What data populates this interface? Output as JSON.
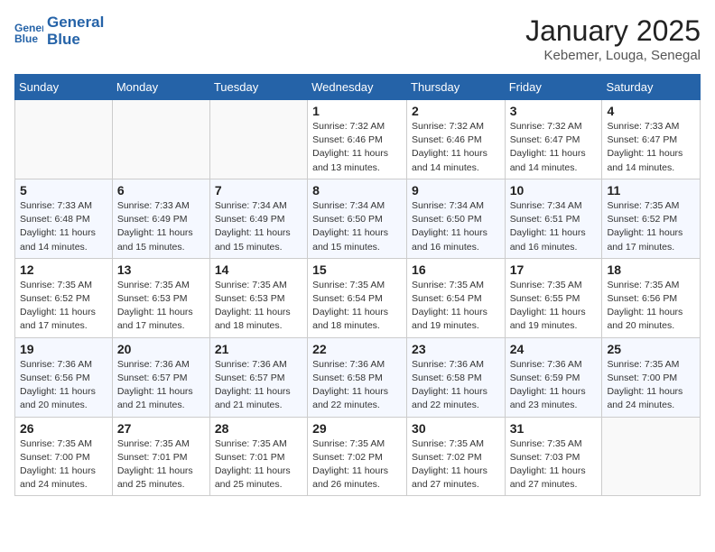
{
  "header": {
    "logo_line1": "General",
    "logo_line2": "Blue",
    "month_title": "January 2025",
    "location": "Kebemer, Louga, Senegal"
  },
  "weekdays": [
    "Sunday",
    "Monday",
    "Tuesday",
    "Wednesday",
    "Thursday",
    "Friday",
    "Saturday"
  ],
  "weeks": [
    [
      {
        "day": "",
        "info": ""
      },
      {
        "day": "",
        "info": ""
      },
      {
        "day": "",
        "info": ""
      },
      {
        "day": "1",
        "info": "Sunrise: 7:32 AM\nSunset: 6:46 PM\nDaylight: 11 hours\nand 13 minutes."
      },
      {
        "day": "2",
        "info": "Sunrise: 7:32 AM\nSunset: 6:46 PM\nDaylight: 11 hours\nand 14 minutes."
      },
      {
        "day": "3",
        "info": "Sunrise: 7:32 AM\nSunset: 6:47 PM\nDaylight: 11 hours\nand 14 minutes."
      },
      {
        "day": "4",
        "info": "Sunrise: 7:33 AM\nSunset: 6:47 PM\nDaylight: 11 hours\nand 14 minutes."
      }
    ],
    [
      {
        "day": "5",
        "info": "Sunrise: 7:33 AM\nSunset: 6:48 PM\nDaylight: 11 hours\nand 14 minutes."
      },
      {
        "day": "6",
        "info": "Sunrise: 7:33 AM\nSunset: 6:49 PM\nDaylight: 11 hours\nand 15 minutes."
      },
      {
        "day": "7",
        "info": "Sunrise: 7:34 AM\nSunset: 6:49 PM\nDaylight: 11 hours\nand 15 minutes."
      },
      {
        "day": "8",
        "info": "Sunrise: 7:34 AM\nSunset: 6:50 PM\nDaylight: 11 hours\nand 15 minutes."
      },
      {
        "day": "9",
        "info": "Sunrise: 7:34 AM\nSunset: 6:50 PM\nDaylight: 11 hours\nand 16 minutes."
      },
      {
        "day": "10",
        "info": "Sunrise: 7:34 AM\nSunset: 6:51 PM\nDaylight: 11 hours\nand 16 minutes."
      },
      {
        "day": "11",
        "info": "Sunrise: 7:35 AM\nSunset: 6:52 PM\nDaylight: 11 hours\nand 17 minutes."
      }
    ],
    [
      {
        "day": "12",
        "info": "Sunrise: 7:35 AM\nSunset: 6:52 PM\nDaylight: 11 hours\nand 17 minutes."
      },
      {
        "day": "13",
        "info": "Sunrise: 7:35 AM\nSunset: 6:53 PM\nDaylight: 11 hours\nand 17 minutes."
      },
      {
        "day": "14",
        "info": "Sunrise: 7:35 AM\nSunset: 6:53 PM\nDaylight: 11 hours\nand 18 minutes."
      },
      {
        "day": "15",
        "info": "Sunrise: 7:35 AM\nSunset: 6:54 PM\nDaylight: 11 hours\nand 18 minutes."
      },
      {
        "day": "16",
        "info": "Sunrise: 7:35 AM\nSunset: 6:54 PM\nDaylight: 11 hours\nand 19 minutes."
      },
      {
        "day": "17",
        "info": "Sunrise: 7:35 AM\nSunset: 6:55 PM\nDaylight: 11 hours\nand 19 minutes."
      },
      {
        "day": "18",
        "info": "Sunrise: 7:35 AM\nSunset: 6:56 PM\nDaylight: 11 hours\nand 20 minutes."
      }
    ],
    [
      {
        "day": "19",
        "info": "Sunrise: 7:36 AM\nSunset: 6:56 PM\nDaylight: 11 hours\nand 20 minutes."
      },
      {
        "day": "20",
        "info": "Sunrise: 7:36 AM\nSunset: 6:57 PM\nDaylight: 11 hours\nand 21 minutes."
      },
      {
        "day": "21",
        "info": "Sunrise: 7:36 AM\nSunset: 6:57 PM\nDaylight: 11 hours\nand 21 minutes."
      },
      {
        "day": "22",
        "info": "Sunrise: 7:36 AM\nSunset: 6:58 PM\nDaylight: 11 hours\nand 22 minutes."
      },
      {
        "day": "23",
        "info": "Sunrise: 7:36 AM\nSunset: 6:58 PM\nDaylight: 11 hours\nand 22 minutes."
      },
      {
        "day": "24",
        "info": "Sunrise: 7:36 AM\nSunset: 6:59 PM\nDaylight: 11 hours\nand 23 minutes."
      },
      {
        "day": "25",
        "info": "Sunrise: 7:35 AM\nSunset: 7:00 PM\nDaylight: 11 hours\nand 24 minutes."
      }
    ],
    [
      {
        "day": "26",
        "info": "Sunrise: 7:35 AM\nSunset: 7:00 PM\nDaylight: 11 hours\nand 24 minutes."
      },
      {
        "day": "27",
        "info": "Sunrise: 7:35 AM\nSunset: 7:01 PM\nDaylight: 11 hours\nand 25 minutes."
      },
      {
        "day": "28",
        "info": "Sunrise: 7:35 AM\nSunset: 7:01 PM\nDaylight: 11 hours\nand 25 minutes."
      },
      {
        "day": "29",
        "info": "Sunrise: 7:35 AM\nSunset: 7:02 PM\nDaylight: 11 hours\nand 26 minutes."
      },
      {
        "day": "30",
        "info": "Sunrise: 7:35 AM\nSunset: 7:02 PM\nDaylight: 11 hours\nand 27 minutes."
      },
      {
        "day": "31",
        "info": "Sunrise: 7:35 AM\nSunset: 7:03 PM\nDaylight: 11 hours\nand 27 minutes."
      },
      {
        "day": "",
        "info": ""
      }
    ]
  ]
}
